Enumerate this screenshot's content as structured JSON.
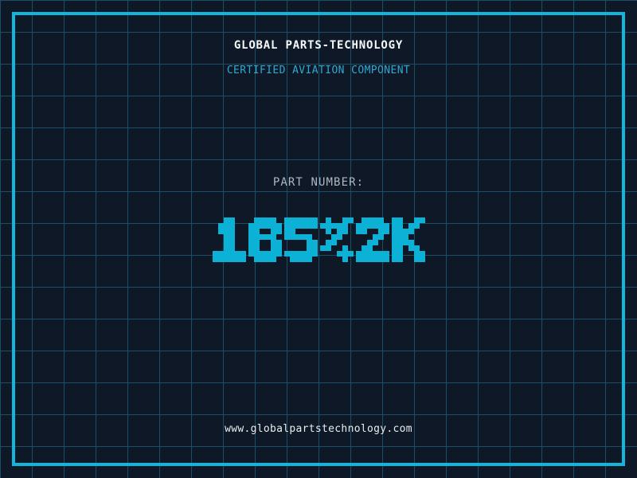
{
  "header": {
    "title": "GLOBAL PARTS-TECHNOLOGY",
    "subtitle": "CERTIFIED AVIATION COMPONENT"
  },
  "part": {
    "label": "PART NUMBER:",
    "number": "165%2K"
  },
  "footer": {
    "website": "www.globalpartstechnology.com"
  },
  "colors": {
    "background": "#0f1826",
    "grid_line": "#1a4f63",
    "frame": "#10b6dc",
    "title": "#f5f8fa",
    "subtitle": "#2ea9d1",
    "part_label": "#aeb7c0",
    "part_number": "#0cb2d6",
    "website": "#e9edf0"
  }
}
